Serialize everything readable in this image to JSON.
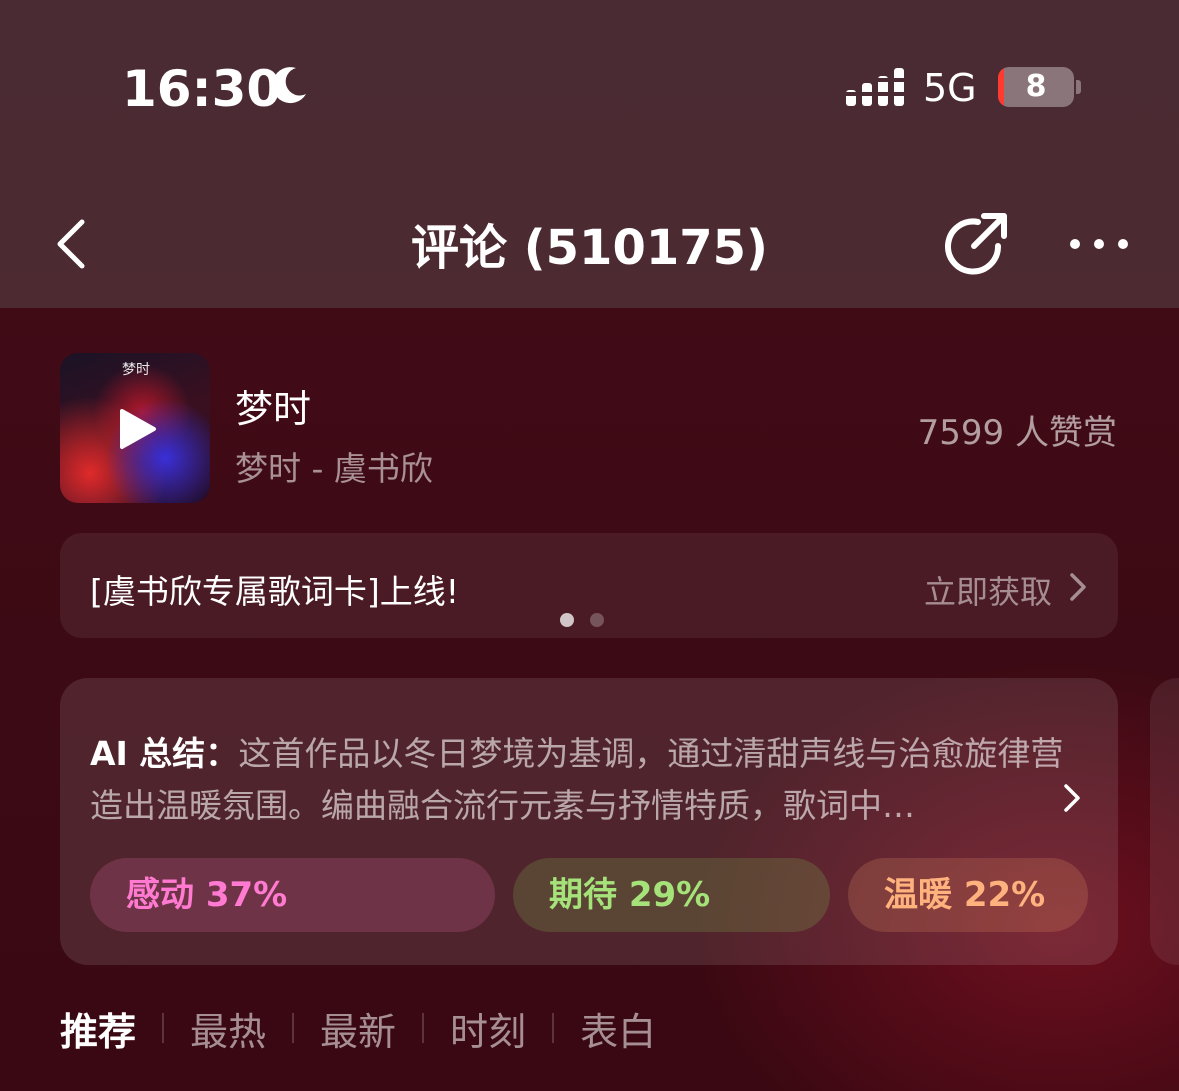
{
  "status_bar": {
    "time": "16:30",
    "network": "5G",
    "battery_level": "8",
    "battery_fill_fraction": 0.08,
    "moon_icon": "moon-icon",
    "signal_icon": "signal-bars-icon"
  },
  "nav": {
    "title": "评论 (510175)",
    "back_icon": "chevron-left-icon",
    "share_icon": "share-arrow-icon",
    "more_icon": "more-dots-icon"
  },
  "song": {
    "cover_text": "梦时",
    "title": "梦时",
    "subtitle": "梦时 - 虞书欣",
    "praise": "7599 人赞赏"
  },
  "banner": {
    "text": "[虞书欣专属歌词卡]上线!",
    "action": "立即获取",
    "page_count": 2,
    "active_page": 1
  },
  "ai_summary": {
    "label": "AI 总结：",
    "text": "这首作品以冬日梦境为基调，通过清甜声线与治愈旋律营造出温暖氛围。编曲融合流行元素与抒情特质，歌词中…",
    "tags": [
      {
        "label": "感动 37%",
        "color": "#ff7ad0"
      },
      {
        "label": "期待 29%",
        "color": "#a6e27a"
      },
      {
        "label": "温暖 22%",
        "color": "#ffb27d"
      }
    ]
  },
  "tabs": [
    {
      "label": "推荐",
      "active": true
    },
    {
      "label": "最热",
      "active": false
    },
    {
      "label": "最新",
      "active": false
    },
    {
      "label": "时刻",
      "active": false
    },
    {
      "label": "表白",
      "active": false
    }
  ],
  "colors": {
    "header_bg": "#4a2b33",
    "content_bg": "#3c0a14",
    "battery_low": "#ff3b30"
  }
}
